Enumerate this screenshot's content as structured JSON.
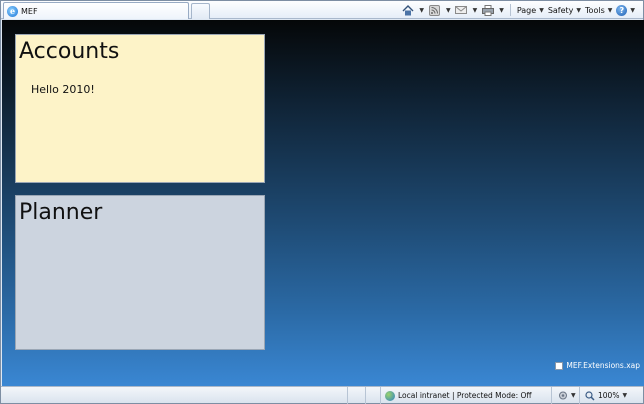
{
  "browser": {
    "tab_title": "MEF",
    "commands": {
      "page_label": "Page",
      "safety_label": "Safety",
      "tools_label": "Tools"
    },
    "icons": [
      "home-icon",
      "feeds-icon",
      "mail-icon",
      "print-icon",
      "help-icon"
    ]
  },
  "app": {
    "accounts": {
      "title": "Accounts",
      "message": "Hello 2010!"
    },
    "planner": {
      "title": "Planner"
    },
    "extension": {
      "label": "MEF.Extensions.xap"
    }
  },
  "statusbar": {
    "zone_text": "Local intranet | Protected Mode: Off",
    "zoom": "100%"
  },
  "colors": {
    "accounts_bg": "#fdf3c8",
    "planner_bg": "#ccd4df",
    "gradient_top": "#050708",
    "gradient_bottom": "#3a87d3"
  }
}
